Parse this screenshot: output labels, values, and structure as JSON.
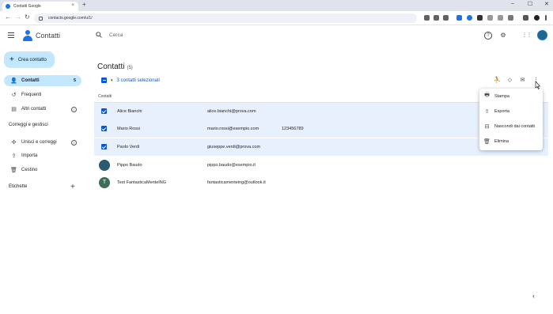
{
  "browser": {
    "tab_title": "Contatti Google",
    "tab_close": "×",
    "new_tab": "+",
    "url": "contacts.google.com/u/1/",
    "back": "←",
    "forward": "→",
    "reload": "↻",
    "minimize": "–",
    "maximize": "☐",
    "close": "✕"
  },
  "header": {
    "app_title": "Contatti",
    "search_placeholder": "Cerca",
    "help_glyph": "?",
    "settings_glyph": "⚙",
    "apps_glyph": "⋮⋮"
  },
  "sidebar": {
    "create_label": "Crea contatto",
    "create_glyph": "+",
    "items": [
      {
        "label": "Contatti",
        "count": "5",
        "glyph": "👤"
      },
      {
        "label": "Frequenti",
        "glyph": "↺"
      },
      {
        "label": "Altri contatti",
        "glyph": "▤",
        "info": "i"
      }
    ],
    "section_fix": "Correggi e gestisci",
    "fix_items": [
      {
        "label": "Unisci e correggi",
        "glyph": "✣",
        "info": "i"
      },
      {
        "label": "Importa",
        "glyph": "⇪"
      },
      {
        "label": "Cestino",
        "glyph": "🗑"
      }
    ],
    "section_labels": "Etichette",
    "labels_add": "+"
  },
  "main": {
    "title": "Contatti",
    "count": "(5)",
    "selection_text": "3 contatti selezionati",
    "caret": "▾",
    "column_header": "Contatti",
    "actions": {
      "assign_glyph": "⛹",
      "label_glyph": "◇",
      "email_glyph": "✉",
      "more_glyph": "⋮"
    },
    "rows": [
      {
        "name": "Alice Bianchi",
        "email": "alice.bianchi@prova.com",
        "phone": "",
        "selected": true
      },
      {
        "name": "Mario Rossi",
        "email": "mario.rossi@esempio.com",
        "phone": "123456789",
        "selected": true
      },
      {
        "name": "Paolo Verdi",
        "email": "giuseppe.verdi@prova.com",
        "phone": "",
        "selected": true
      },
      {
        "name": "Pippo Baudo",
        "email": "pippo.baudo@esempio.it",
        "phone": "",
        "selected": false,
        "avatar": ""
      },
      {
        "name": "Test FantasticaMenteING",
        "email": "fantasticamenteing@outlook.it",
        "phone": "",
        "selected": false,
        "avatar": "T"
      }
    ]
  },
  "menu": {
    "items": [
      {
        "label": "Stampa",
        "glyph": "🖶"
      },
      {
        "label": "Esporta",
        "glyph": "⇧"
      },
      {
        "label": "Nascondi dai contatti",
        "glyph": "⊟"
      },
      {
        "label": "Elimina",
        "glyph": "🗑"
      }
    ]
  },
  "footer": {
    "collapse_glyph": "‹"
  },
  "colors": {
    "accent": "#0b57d0",
    "selected_row": "#e8f0fe",
    "create_button": "#c2e7ff"
  }
}
